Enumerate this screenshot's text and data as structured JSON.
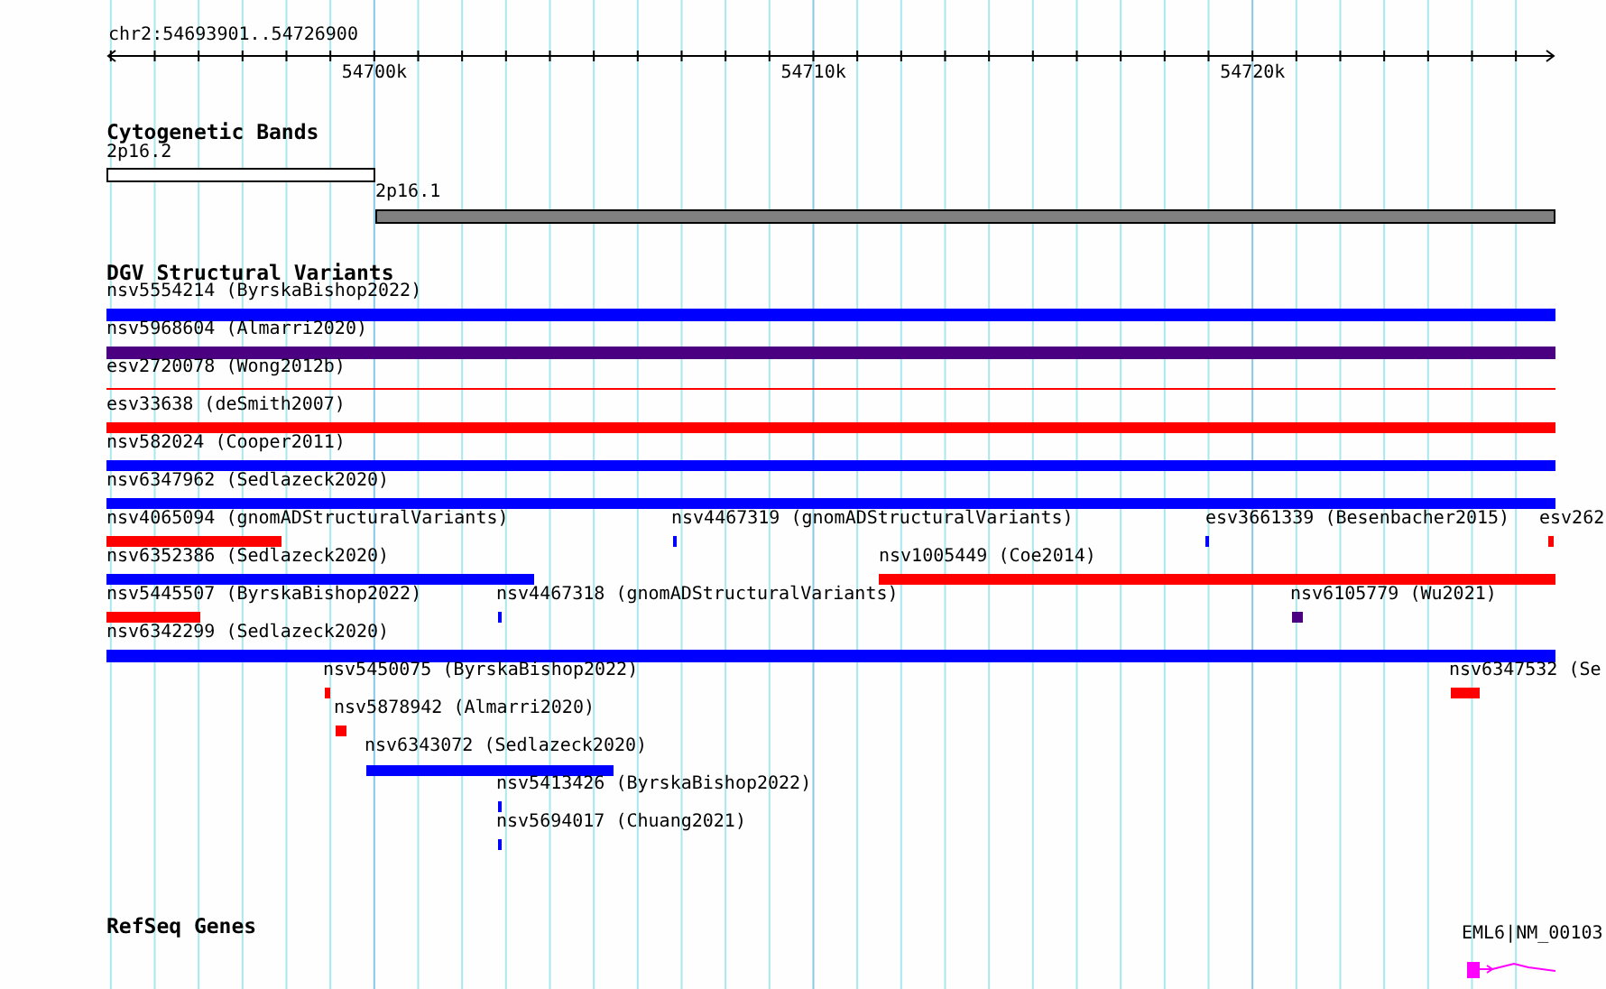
{
  "ruler": {
    "location": "chr2:54693901..54726900",
    "ticks": [
      "54700k",
      "54710k",
      "54720k"
    ]
  },
  "tracks": [
    {
      "title": "Cytogenetic Bands",
      "kind": "bands",
      "features": [
        {
          "label": "2p16.2",
          "color": "#ffffff"
        },
        {
          "label": "2p16.1",
          "color": "#808080"
        }
      ]
    },
    {
      "title": "DGV Structural Variants",
      "kind": "variants",
      "features": [
        {
          "label": "nsv5554214 (ByrskaBishop2022)",
          "color": "#0000ff"
        },
        {
          "label": "nsv5968604 (Almarri2020)",
          "color": "#4b0082"
        },
        {
          "label": "esv2720078 (Wong2012b)",
          "color": "#ff0000"
        },
        {
          "label": "esv33638 (deSmith2007)",
          "color": "#ff0000"
        },
        {
          "label": "nsv582024 (Cooper2011)",
          "color": "#0000ff"
        },
        {
          "label": "nsv6347962 (Sedlazeck2020)",
          "color": "#0000ff"
        },
        {
          "label": "nsv4065094 (gnomADStructuralVariants)",
          "color": "#ff0000"
        },
        {
          "label": "nsv4467319 (gnomADStructuralVariants)",
          "color": "#0000ff"
        },
        {
          "label": "esv3661339 (Besenbacher2015)",
          "color": "#0000ff"
        },
        {
          "label": "esv262",
          "color": "#ff0000"
        },
        {
          "label": "nsv6352386 (Sedlazeck2020)",
          "color": "#0000ff"
        },
        {
          "label": "nsv1005449 (Coe2014)",
          "color": "#ff0000"
        },
        {
          "label": "nsv5445507 (ByrskaBishop2022)",
          "color": "#ff0000"
        },
        {
          "label": "nsv4467318 (gnomADStructuralVariants)",
          "color": "#0000ff"
        },
        {
          "label": "nsv6105779 (Wu2021)",
          "color": "#4b0082"
        },
        {
          "label": "nsv6342299 (Sedlazeck2020)",
          "color": "#0000ff"
        },
        {
          "label": "nsv5450075 (ByrskaBishop2022)",
          "color": "#ff0000"
        },
        {
          "label": "nsv6347532 (Se",
          "color": "#ff0000"
        },
        {
          "label": "nsv5878942 (Almarri2020)",
          "color": "#ff0000"
        },
        {
          "label": "nsv6343072 (Sedlazeck2020)",
          "color": "#0000ff"
        },
        {
          "label": "nsv5413426 (ByrskaBishop2022)",
          "color": "#0000ff"
        },
        {
          "label": "nsv5694017 (Chuang2021)",
          "color": "#0000ff"
        }
      ]
    },
    {
      "title": "RefSeq Genes",
      "kind": "genes",
      "features": [
        {
          "label": "EML6|NM_00103",
          "color": "#ff00ff"
        }
      ]
    }
  ]
}
